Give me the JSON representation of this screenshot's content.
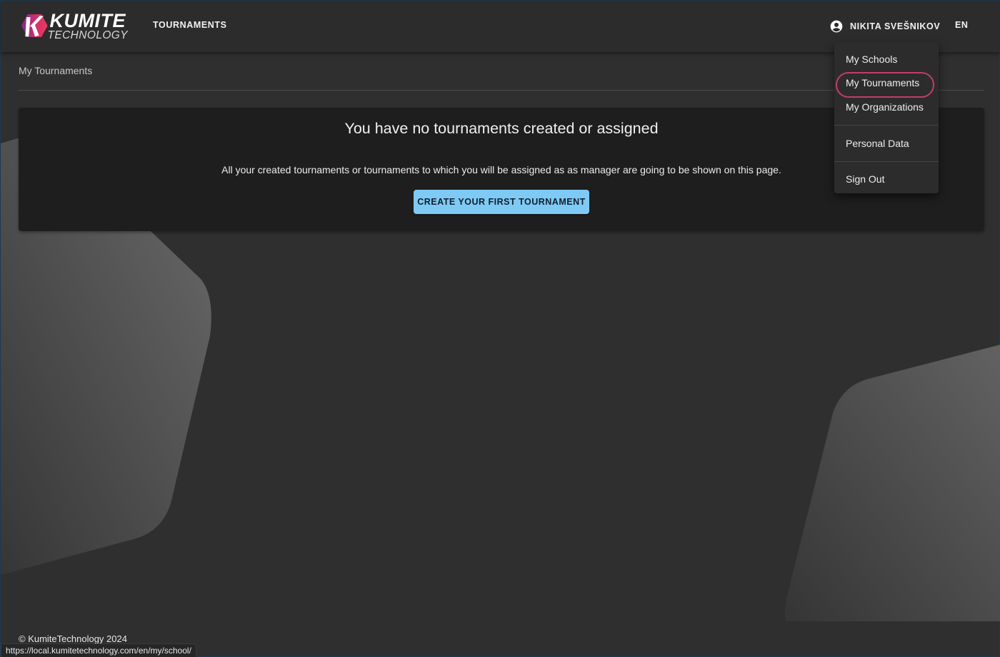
{
  "header": {
    "logo": {
      "primary": "KUMITE",
      "secondary": "TECHNOLOGY"
    },
    "nav": [
      {
        "label": "TOURNAMENTS"
      }
    ],
    "user": {
      "name": "NIKITA SVEŠNIKOV",
      "icon": "account-circle-icon"
    },
    "language": "EN"
  },
  "user_menu": {
    "items": [
      {
        "label": "My Schools"
      },
      {
        "label": "My Tournaments",
        "highlighted": true
      },
      {
        "label": "My Organizations"
      },
      {
        "label": "Personal Data"
      },
      {
        "label": "Sign Out"
      }
    ],
    "highlight_color": "#c43c6e"
  },
  "page": {
    "breadcrumb": "My Tournaments",
    "empty_state": {
      "title": "You have no tournaments created or assigned",
      "description": "All your created tournaments or tournaments to which you will be assigned as as manager are going to be shown on this page.",
      "button_label": "CREATE YOUR FIRST TOURNAMENT"
    }
  },
  "footer": {
    "copyright": "© KumiteTechnology 2024"
  },
  "status_bar": {
    "url": "https://local.kumitetechnology.com/en/my/school/"
  },
  "colors": {
    "accent": "#7fcaf5",
    "background": "#2f2f2f",
    "card": "#1e1e1e",
    "logo_gradient": [
      "#7b2a8a",
      "#e83560"
    ]
  }
}
